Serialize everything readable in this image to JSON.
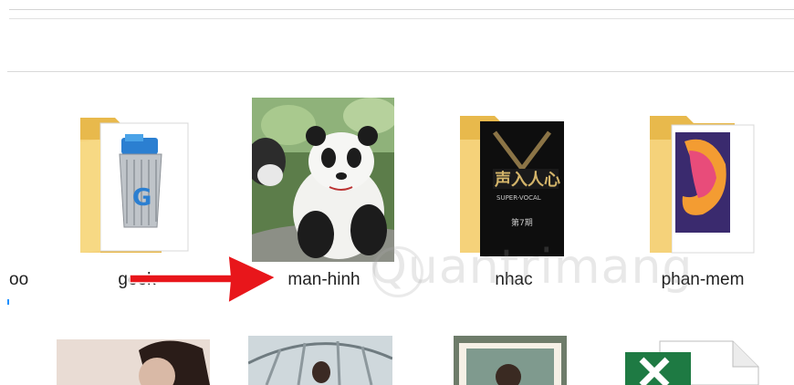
{
  "row1": [
    {
      "label": "oo"
    },
    {
      "label": "geek"
    },
    {
      "label": "man-hinh"
    },
    {
      "label": "nhac"
    },
    {
      "label": "phan-mem"
    }
  ],
  "watermark": "Quantrimang",
  "icons": {
    "folder_color": "#f5d27a",
    "folder_dark": "#e8b94c",
    "arrow_color": "#e8161b"
  }
}
